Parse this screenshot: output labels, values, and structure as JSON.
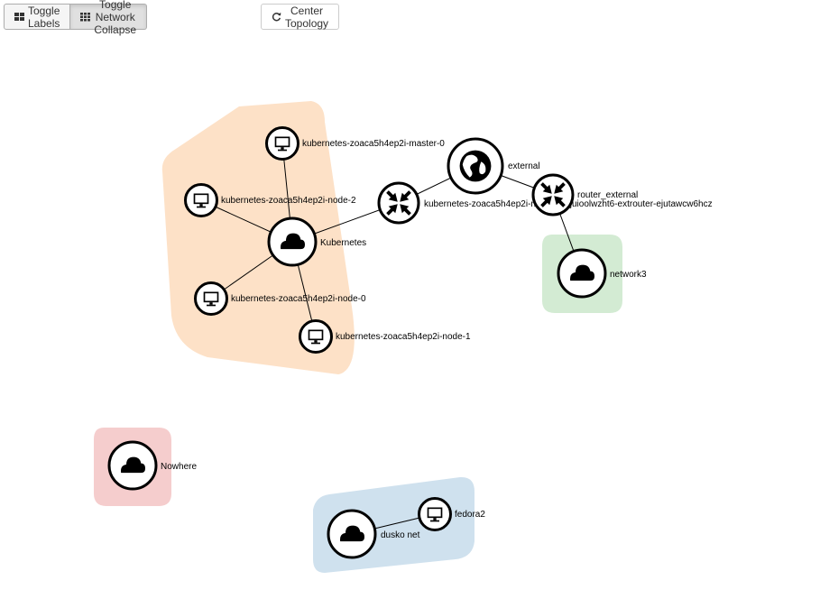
{
  "toolbar": {
    "toggle_labels": "Toggle Labels",
    "toggle_collapse": "Toggle Network Collapse",
    "center_topology": "Center Topology",
    "toggle_labels_icon": "th-large-icon",
    "toggle_collapse_icon": "th-icon",
    "center_icon": "refresh-icon"
  },
  "groups": {
    "kubernetes": {
      "color": "#fde1c7"
    },
    "network3": {
      "color": "#d3ebd3"
    },
    "nowhere": {
      "color": "#f5cdcd"
    },
    "dusko": {
      "color": "#cfe1ee"
    }
  },
  "nodes": {
    "master0": {
      "label": "kubernetes-zoaca5h4ep2i-master-0",
      "icon": "monitor-icon"
    },
    "node2": {
      "label": "kubernetes-zoaca5h4ep2i-node-2",
      "icon": "monitor-icon"
    },
    "kubernetes": {
      "label": "Kubernetes",
      "icon": "cloud-icon"
    },
    "node0": {
      "label": "kubernetes-zoaca5h4ep2i-node-0",
      "icon": "monitor-icon"
    },
    "node1": {
      "label": "kubernetes-zoaca5h4ep2i-node-1",
      "icon": "monitor-icon"
    },
    "k8s_router": {
      "label": "kubernetes-zoaca5h4ep2i-network-zjuioolwzht6-extrouter-ejutawcw6hcz",
      "icon": "router-icon"
    },
    "external": {
      "label": "external",
      "icon": "globe-icon"
    },
    "router_external": {
      "label": "router_external",
      "icon": "router-icon"
    },
    "network3": {
      "label": "network3",
      "icon": "cloud-icon"
    },
    "nowhere": {
      "label": "Nowhere",
      "icon": "cloud-icon"
    },
    "dusko": {
      "label": "dusko net",
      "icon": "cloud-icon"
    },
    "fedora2": {
      "label": "fedora2",
      "icon": "monitor-icon"
    }
  }
}
